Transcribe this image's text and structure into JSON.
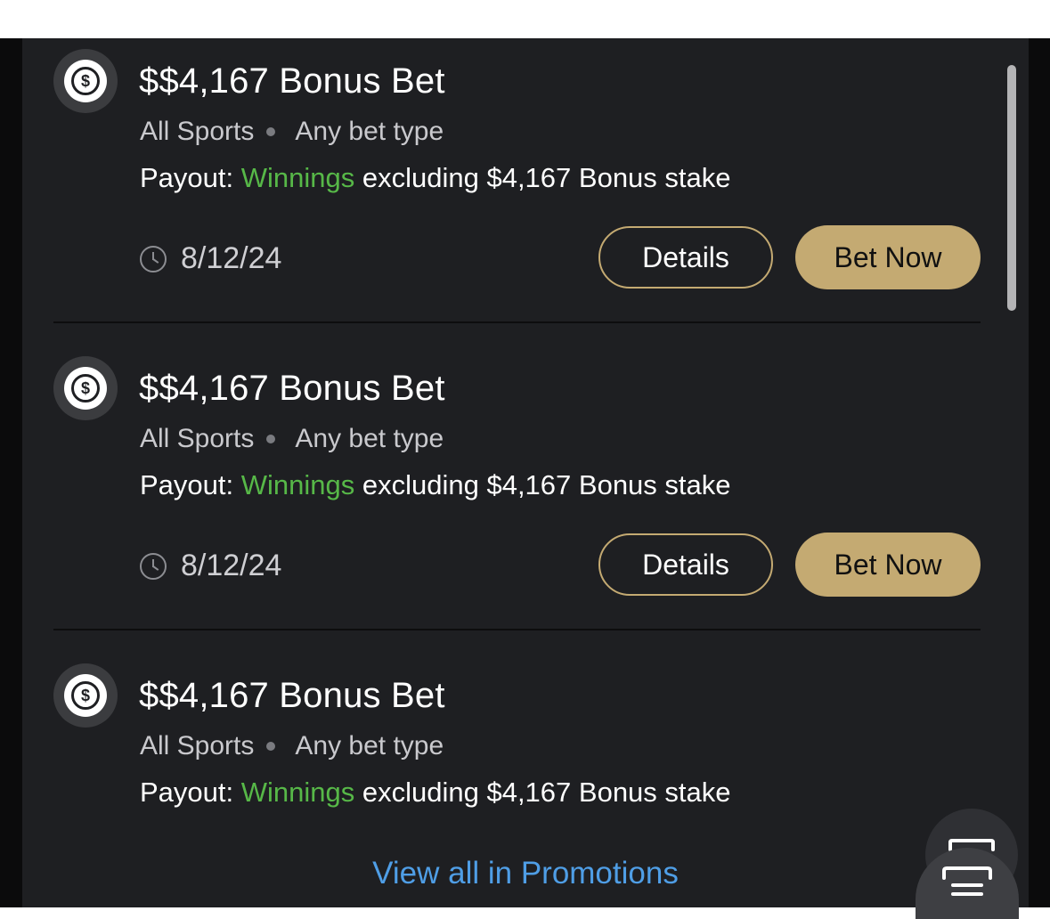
{
  "promotions": [
    {
      "title": "$$4,167 Bonus Bet",
      "sport": "All Sports",
      "bet_type": "Any bet type",
      "payout_label": "Payout:",
      "payout_highlight": "Winnings",
      "payout_rest": "excluding $4,167 Bonus stake",
      "date": "8/12/24",
      "details_label": "Details",
      "bet_now_label": "Bet Now"
    },
    {
      "title": "$$4,167 Bonus Bet",
      "sport": "All Sports",
      "bet_type": "Any bet type",
      "payout_label": "Payout:",
      "payout_highlight": "Winnings",
      "payout_rest": "excluding $4,167 Bonus stake",
      "date": "8/12/24",
      "details_label": "Details",
      "bet_now_label": "Bet Now"
    },
    {
      "title": "$$4,167 Bonus Bet",
      "sport": "All Sports",
      "bet_type": "Any bet type",
      "payout_label": "Payout:",
      "payout_highlight": "Winnings",
      "payout_rest": "excluding $4,167 Bonus stake"
    }
  ],
  "coin_symbol": "$",
  "view_all_label": "View all in Promotions",
  "colors": {
    "panel_bg": "#1e1f22",
    "accent_gold": "#c4aa72",
    "winnings_green": "#57b848",
    "link_blue": "#4f9ee6"
  },
  "icons": [
    "coin-icon",
    "clock-icon",
    "scan-text-icon"
  ]
}
